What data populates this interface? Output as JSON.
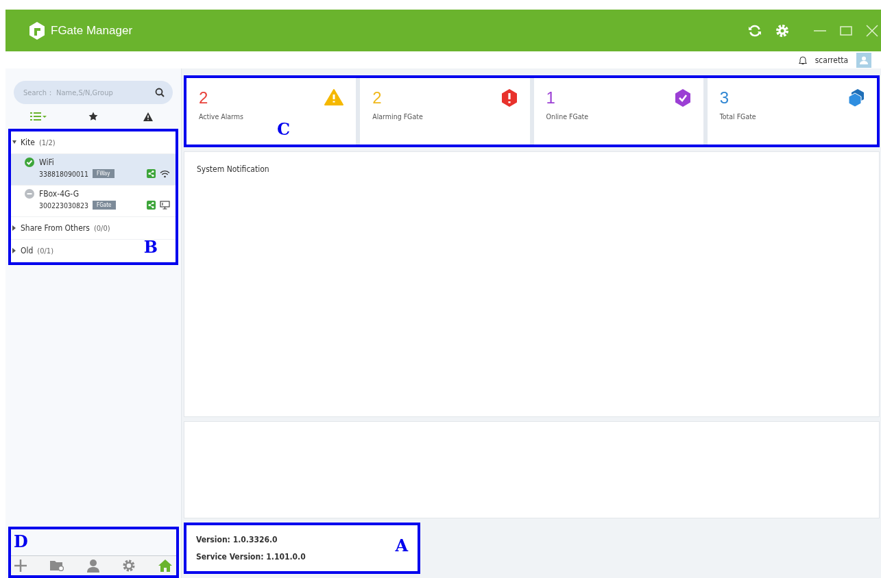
{
  "window": {
    "title": "FGate Manager"
  },
  "userbar": {
    "username": "scarretta"
  },
  "sidebar": {
    "search": {
      "placeholder": "Search： Name,S/N,Group"
    },
    "filters": [
      {
        "kind": "list",
        "selected": true
      },
      {
        "kind": "star",
        "selected": false
      },
      {
        "kind": "alarm",
        "selected": false
      }
    ],
    "tree": [
      {
        "label": "Kite",
        "count": "(1/2)",
        "expanded": true,
        "children": [
          {
            "name": "WiFi",
            "serial": "338818090011",
            "tag": "FWay",
            "online": true,
            "kind": "wifi",
            "selected": true
          },
          {
            "name": "FBox-4G-G",
            "serial": "300223030823",
            "tag": "FGate",
            "online": false,
            "kind": "wired",
            "selected": false
          }
        ]
      },
      {
        "label": "Share From Others",
        "count": "(0/0)",
        "expanded": false
      },
      {
        "label": "Old",
        "count": "(0/1)",
        "expanded": false
      }
    ],
    "toolbar": [
      {
        "kind": "add",
        "selected": false
      },
      {
        "kind": "folder",
        "selected": false
      },
      {
        "kind": "user",
        "selected": false
      },
      {
        "kind": "settings",
        "selected": false
      },
      {
        "kind": "home",
        "selected": true
      }
    ]
  },
  "stats": [
    {
      "value": "2",
      "label": "Active Alarms",
      "color": "#e8413a",
      "kind": "warning"
    },
    {
      "value": "2",
      "label": "Alarming FGate",
      "color": "#f0b81c",
      "kind": "error"
    },
    {
      "value": "1",
      "label": "Online FGate",
      "color": "#9b3fd4",
      "kind": "check"
    },
    {
      "value": "3",
      "label": "Total FGate",
      "color": "#2f86d2",
      "kind": "cubes"
    }
  ],
  "notification": {
    "title": "System Notification"
  },
  "version": {
    "version": "Version: 1.0.3326.0",
    "service_version": "Service Version: 1.101.0.0"
  },
  "callouts": {
    "version": "A",
    "tree": "B",
    "stats": "C",
    "toolbar": "D"
  }
}
